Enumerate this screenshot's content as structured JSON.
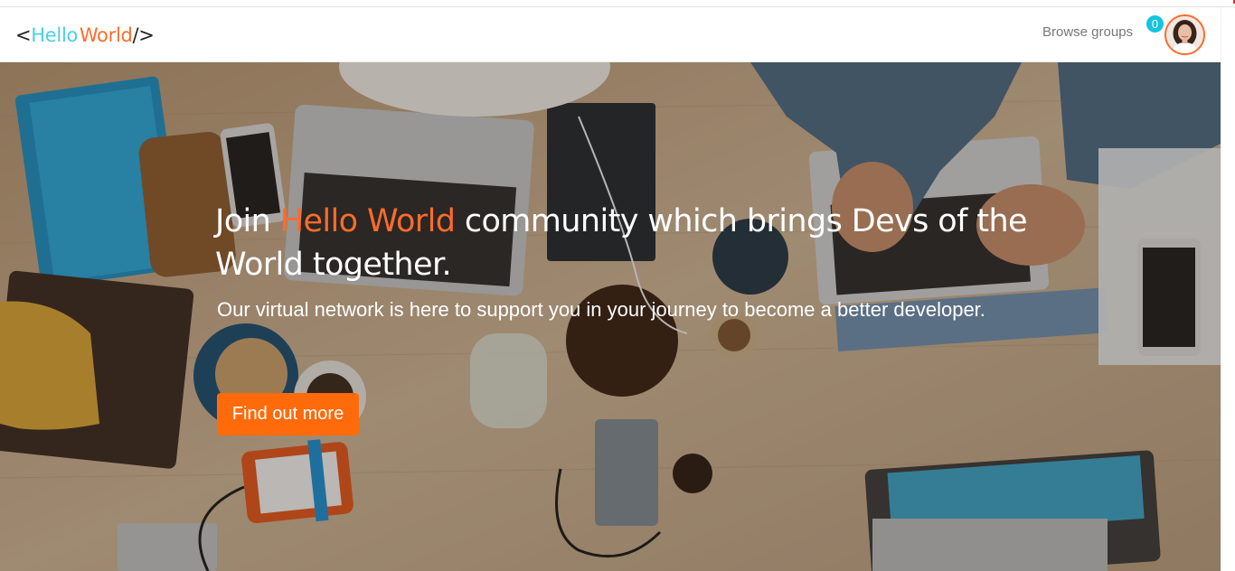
{
  "navbar": {
    "brand_open": "<",
    "brand_hello": "Hello",
    "brand_world": "World",
    "brand_close": "/>",
    "browse_groups": "Browse groups",
    "notification_count": "0"
  },
  "hero": {
    "headline_prefix": "Join ",
    "headline_accent": "Hello World",
    "headline_suffix": " community which brings Devs of the World together.",
    "subline": "Our virtual network is here to support you in your journey to become a better developer.",
    "cta_label": "Find out more"
  },
  "colors": {
    "accent_orange": "#ff6b2b",
    "brand_cyan": "#4dd0e1",
    "badge_cyan": "#16c4dd",
    "button_orange": "#ff6b0a"
  }
}
